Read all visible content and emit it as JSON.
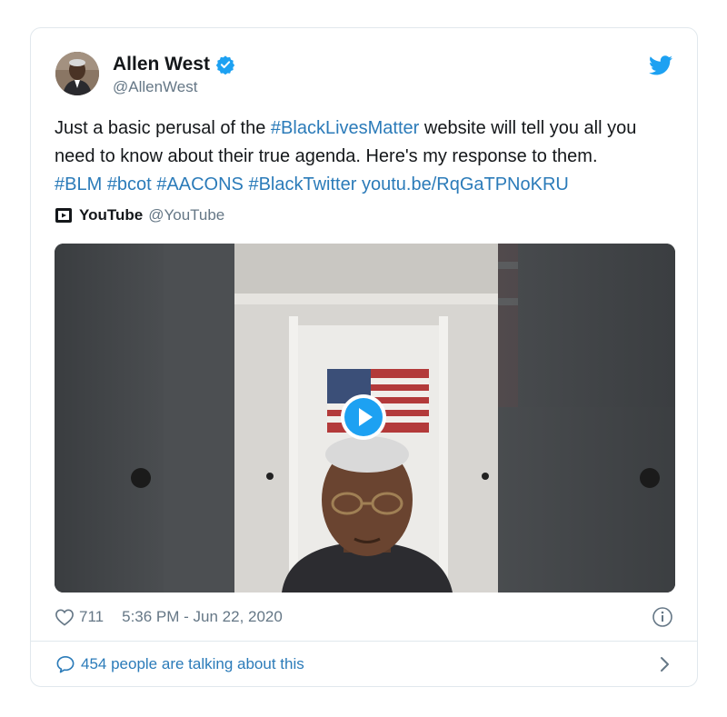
{
  "tweet": {
    "author_name": "Allen West",
    "handle": "@AllenWest",
    "text_plain_1": "Just a basic perusal of the ",
    "hashtag_blm_full": "#BlackLivesMatter",
    "text_plain_2": " website will tell you all you need to know about their true agenda. Here's my response to them.",
    "tags": [
      "#BLM",
      "#bcot",
      "#AACONS",
      "#BlackTwitter"
    ],
    "link": "youtu.be/RqGaTPNoKRU",
    "source_name": "YouTube",
    "source_handle": "@YouTube",
    "likes": "711",
    "timestamp": "5:36 PM - Jun 22, 2020",
    "talking": "454 people are talking about this"
  },
  "icons": {
    "avatar": "avatar",
    "verified": "verified-badge-icon",
    "bird": "twitter-bird-icon",
    "youtube": "youtube-icon",
    "play": "play-icon",
    "like": "heart-icon",
    "info": "info-icon",
    "reply": "comment-bubble-icon",
    "chevron": "chevron-right-icon"
  },
  "colors": {
    "link": "#2b7bb9",
    "twitter_blue": "#1da1f2",
    "text": "#14171a",
    "muted": "#657786",
    "border": "#e1e8ed"
  }
}
